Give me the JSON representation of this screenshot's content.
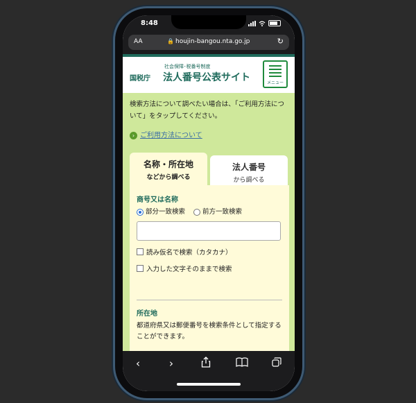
{
  "status_bar": {
    "time": "8:48"
  },
  "browser": {
    "text_size": "AA",
    "url": "houjin-bangou.nta.go.jp"
  },
  "header": {
    "agency": "国税庁",
    "subtitle": "社会保障･税番号制度",
    "title": "法人番号公表サイト",
    "menu_label": "メニュー"
  },
  "intro": {
    "text": "検索方法について調べたい場合は、「ご利用方法について」をタップしてください。",
    "link": "ご利用方法について"
  },
  "tabs": [
    {
      "line1": "名称・所在地",
      "line2": "などから調べる",
      "active": true
    },
    {
      "line1": "法人番号",
      "line2": "から調べる",
      "active": false
    }
  ],
  "name_section": {
    "title": "商号又は名称",
    "radio_partial": "部分一致検索",
    "radio_prefix": "前方一致検索",
    "input_value": "",
    "check_kana": "読み仮名で検索（カタカナ）",
    "check_exact": "入力した文字そのままで検索"
  },
  "location_section": {
    "title": "所在地",
    "description": "都道府県又は郵便番号を検索条件として指定することができます。"
  },
  "colors": {
    "brand_green": "#1f6b5c",
    "page_bg": "#cfe89b",
    "panel_bg": "#fffbd9"
  }
}
